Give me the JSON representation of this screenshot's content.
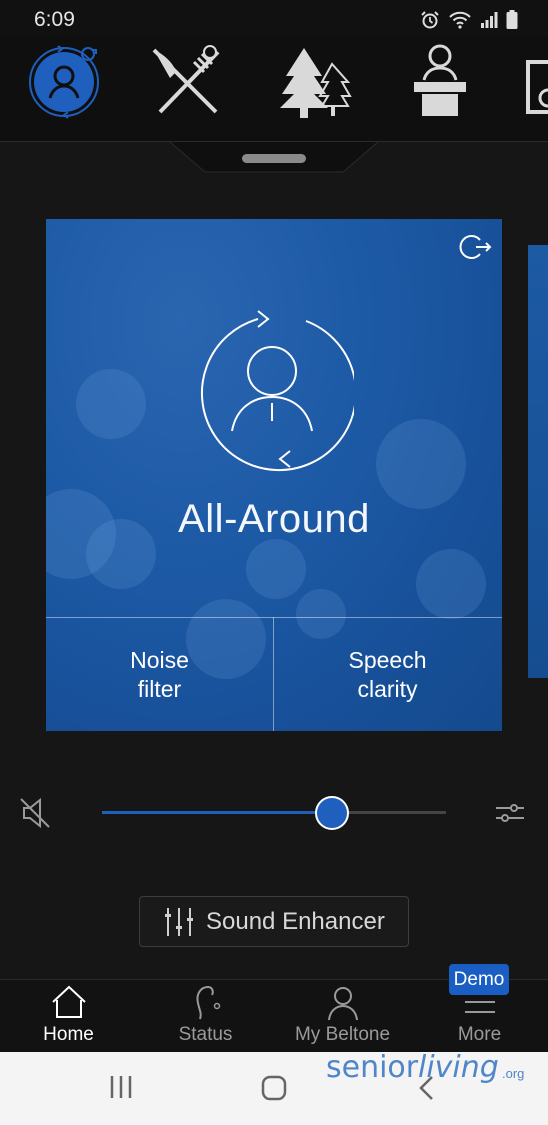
{
  "status_bar": {
    "time": "6:09",
    "icons": [
      "alarm-icon",
      "wifi-icon",
      "signal-icon",
      "battery-icon"
    ]
  },
  "programs": [
    {
      "name": "all-around-program",
      "icon": "person-cycle-icon",
      "active": true
    },
    {
      "name": "restaurant-program",
      "icon": "fork-knife-icon",
      "active": false
    },
    {
      "name": "outdoor-program",
      "icon": "trees-icon",
      "active": false
    },
    {
      "name": "lecture-program",
      "icon": "podium-icon",
      "active": false
    },
    {
      "name": "music-program",
      "icon": "speaker-icon",
      "active": false
    }
  ],
  "card": {
    "title": "All-Around",
    "left_button": "Noise\nfilter",
    "right_button": "Speech\nclarity",
    "colors": {
      "accent": "#1d5aa6",
      "line": "#ffffff"
    }
  },
  "volume": {
    "level": 0.67
  },
  "sound_enhancer": {
    "label": "Sound Enhancer"
  },
  "bottom_nav": {
    "items": [
      {
        "label": "Home",
        "icon": "home-icon",
        "active": true
      },
      {
        "label": "Status",
        "icon": "hearing-aid-icon",
        "active": false
      },
      {
        "label": "My Beltone",
        "icon": "person-icon",
        "active": false
      },
      {
        "label": "More",
        "icon": "menu-icon",
        "active": false
      }
    ],
    "badge": "Demo"
  },
  "watermark": {
    "text_left": "senior",
    "text_right": "living",
    "suffix": ".org"
  },
  "theme": {
    "accent": "#1f5fbd",
    "background": "#161616"
  }
}
